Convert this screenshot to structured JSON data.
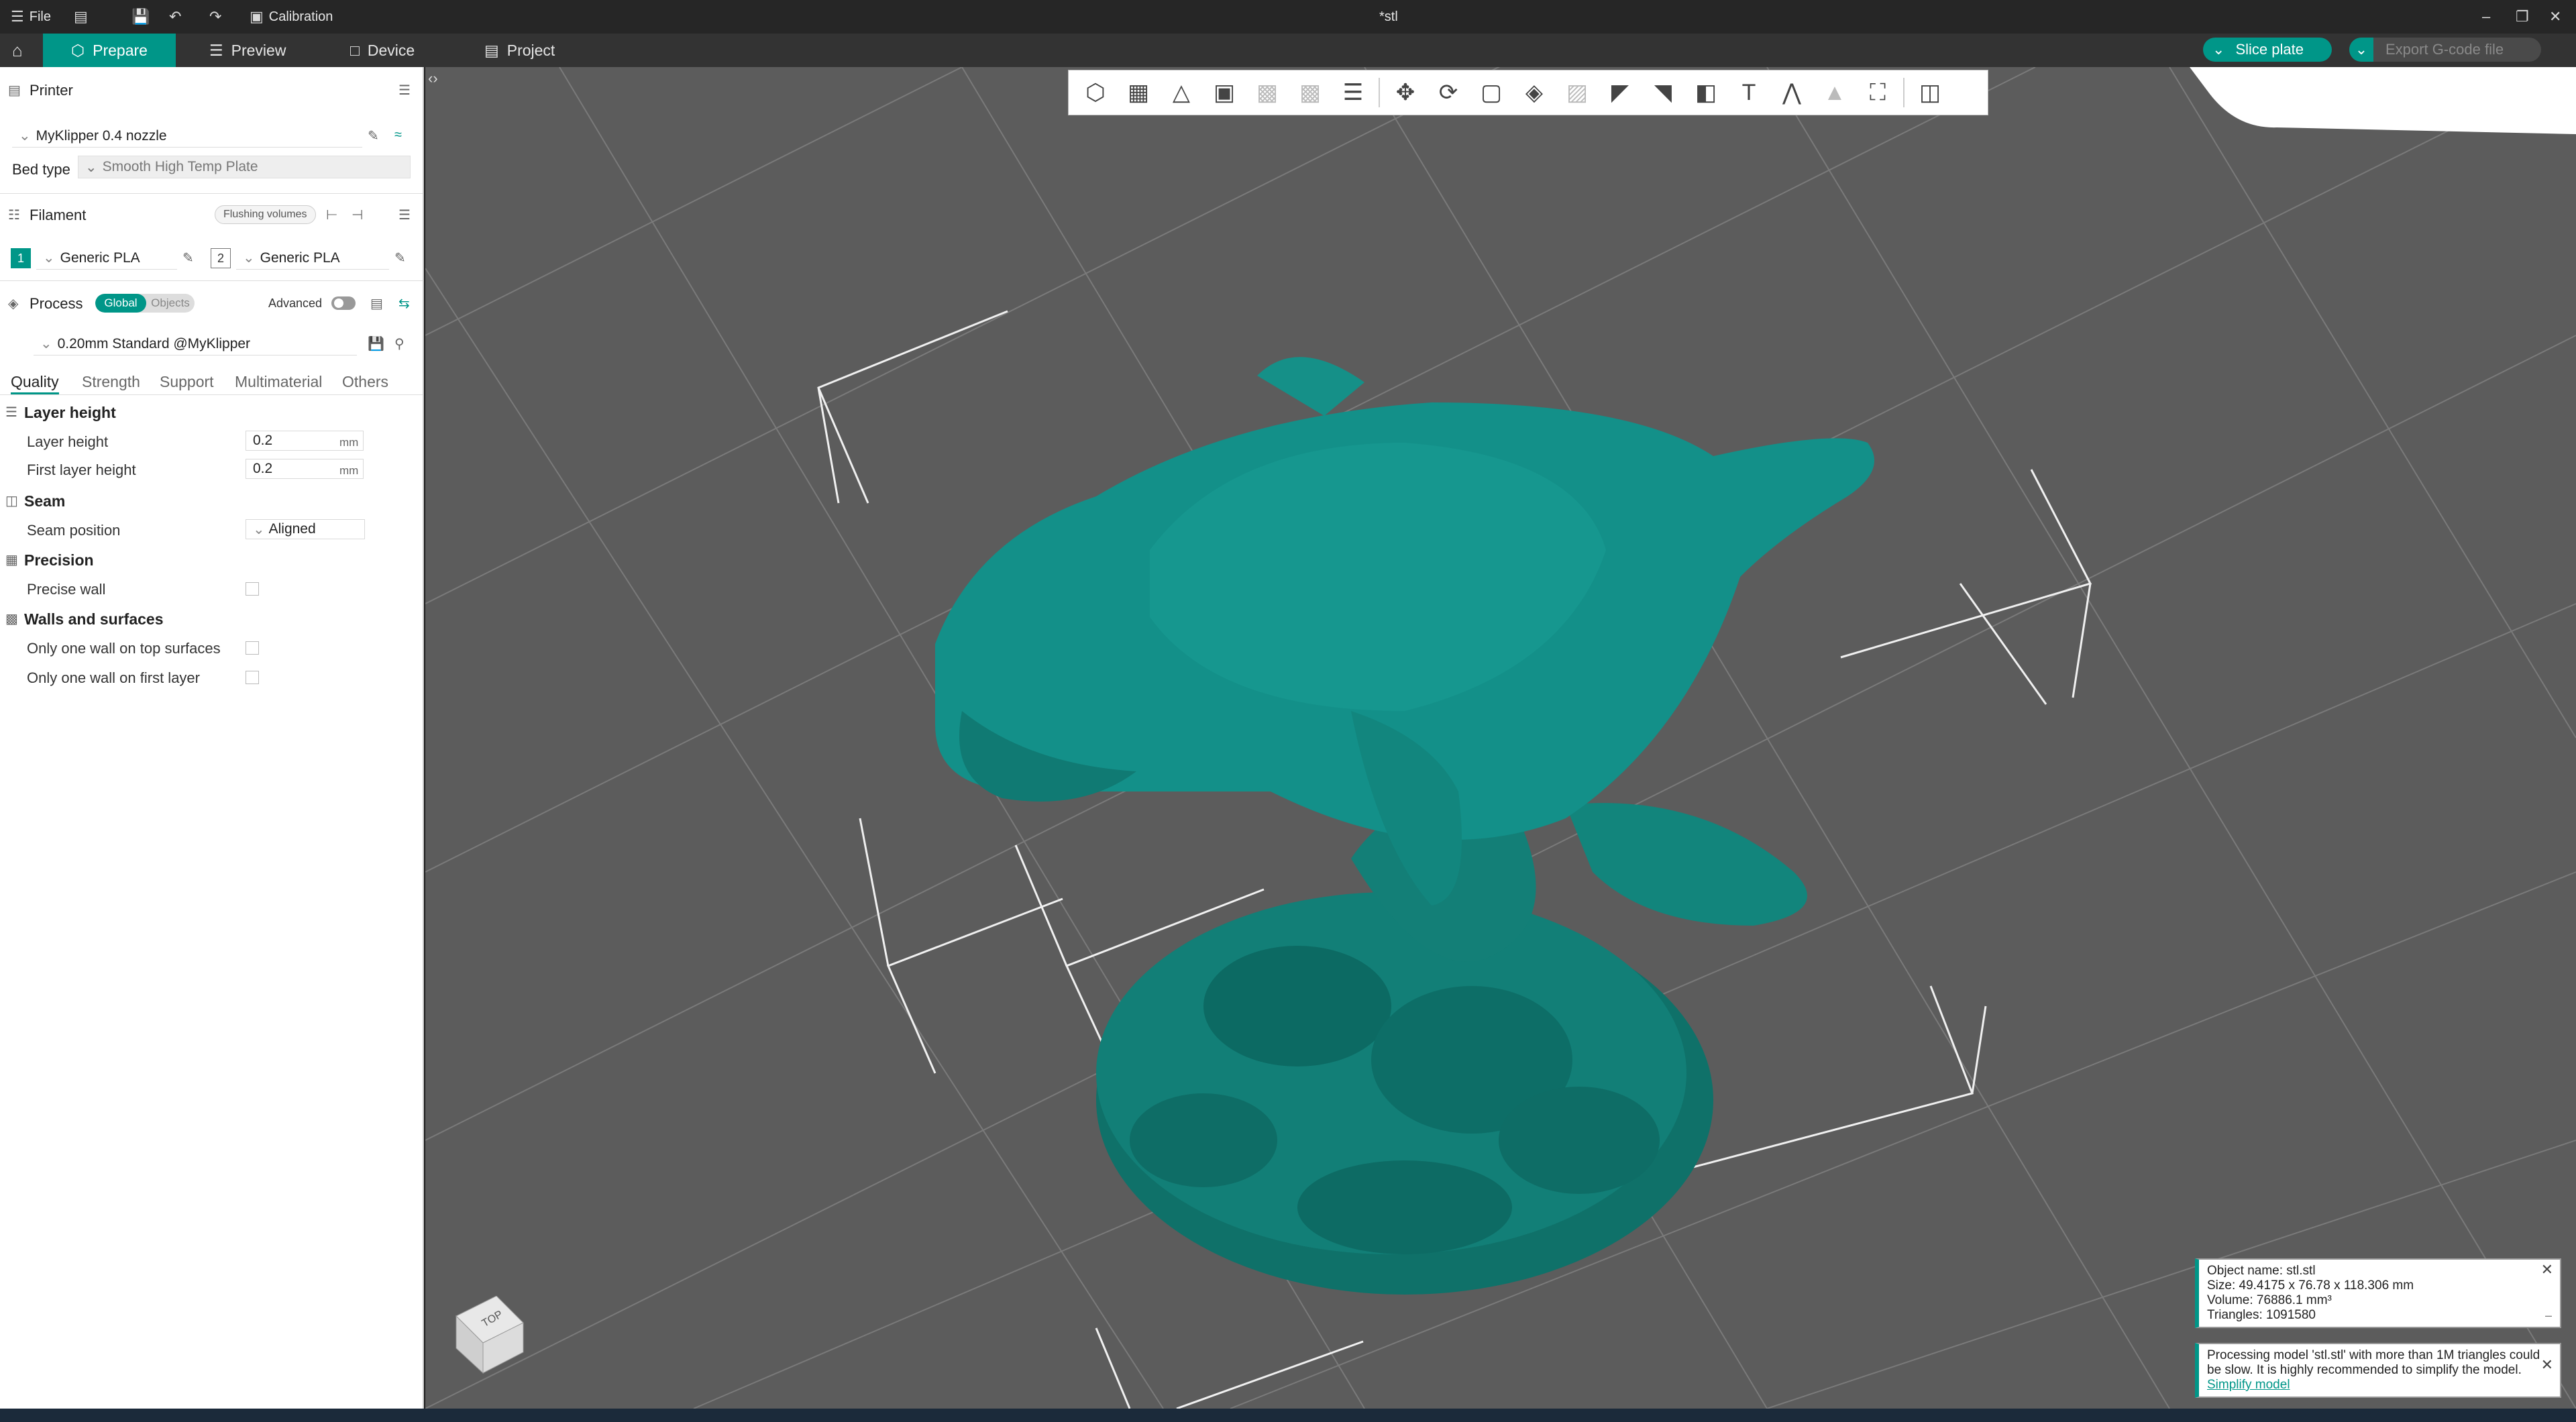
{
  "titlebar": {
    "file_label": "File",
    "calibration_label": "Calibration",
    "window_title": "*stl"
  },
  "menubar": {
    "tabs": [
      {
        "label": "Prepare"
      },
      {
        "label": "Preview"
      },
      {
        "label": "Device"
      },
      {
        "label": "Project"
      }
    ],
    "slice_label": "Slice plate",
    "export_label": "Export G-code file"
  },
  "printer": {
    "section_title": "Printer",
    "preset": "MyKlipper 0.4 nozzle",
    "bed_type_label": "Bed type",
    "bed_type_value": "Smooth High Temp Plate"
  },
  "filament": {
    "section_title": "Filament",
    "flushing_label": "Flushing volumes",
    "slots": [
      {
        "number": "1",
        "name": "Generic PLA"
      },
      {
        "number": "2",
        "name": "Generic PLA"
      }
    ]
  },
  "process": {
    "section_title": "Process",
    "global_label": "Global",
    "objects_label": "Objects",
    "advanced_label": "Advanced",
    "preset": "0.20mm Standard @MyKlipper",
    "tabs": [
      "Quality",
      "Strength",
      "Support",
      "Multimaterial",
      "Others"
    ]
  },
  "quality": {
    "layer_height_group": "Layer height",
    "layer_height_label": "Layer height",
    "layer_height_value": "0.2",
    "first_layer_label": "First layer height",
    "first_layer_value": "0.2",
    "unit": "mm",
    "seam_group": "Seam",
    "seam_position_label": "Seam position",
    "seam_position_value": "Aligned",
    "precision_group": "Precision",
    "precise_wall_label": "Precise wall",
    "walls_group": "Walls and surfaces",
    "one_wall_top_label": "Only one wall on top surfaces",
    "one_wall_first_label": "Only one wall on first layer"
  },
  "viewport": {
    "cube_label": "TOP"
  },
  "object_info": {
    "name": "Object name: stl.stl",
    "size": "Size: 49.4175 x 76.78 x 118.306 mm",
    "volume": "Volume: 76886.1 mm³",
    "triangles": "Triangles: 1091580"
  },
  "processing_notice": {
    "text": "Processing model 'stl.stl' with more than 1M triangles could be slow. It is highly recommended to simplify the model.",
    "link": "Simplify model"
  },
  "colors": {
    "accent": "#009688",
    "model": "#127f77",
    "viewport_bg": "#5c5c5c"
  }
}
